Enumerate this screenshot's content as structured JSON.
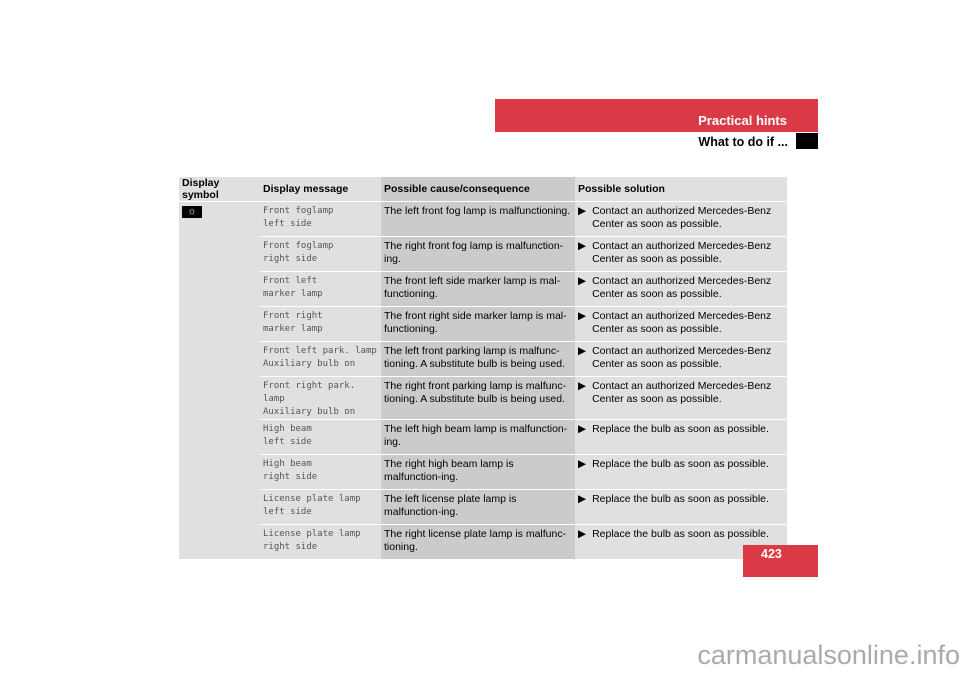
{
  "header": {
    "section": "Practical hints",
    "subsection": "What to do if ..."
  },
  "page_number": "423",
  "watermark": "carmanualsonline.info",
  "table": {
    "headers": [
      "Display symbol",
      "Display message",
      "Possible cause/consequence",
      "Possible solution"
    ],
    "symbol_icon": "lamp-icon",
    "rows": [
      {
        "msg1": "Front foglamp",
        "msg2": "left side",
        "cause": "The left front fog lamp is malfunctioning.",
        "solution": "Contact an authorized Mercedes-Benz Center as soon as possible."
      },
      {
        "msg1": "Front foglamp",
        "msg2": "right side",
        "cause": "The right front fog lamp is malfunction-ing.",
        "solution": "Contact an authorized Mercedes-Benz Center as soon as possible."
      },
      {
        "msg1": "Front left",
        "msg2": "marker lamp",
        "cause": "The front left side marker lamp is mal-functioning.",
        "solution": "Contact an authorized Mercedes-Benz Center as soon as possible."
      },
      {
        "msg1": "Front right",
        "msg2": "marker lamp",
        "cause": "The front right side marker lamp is mal-functioning.",
        "solution": "Contact an authorized Mercedes-Benz Center as soon as possible."
      },
      {
        "msg1": "Front left park. lamp",
        "msg2": "Auxiliary bulb on",
        "cause": "The left front parking lamp is malfunc-tioning. A substitute bulb is being used.",
        "solution": "Contact an authorized Mercedes-Benz Center as soon as possible."
      },
      {
        "msg1": "Front right park. lamp",
        "msg2": "Auxiliary bulb on",
        "cause": "The right front parking lamp is malfunc-tioning. A substitute bulb is being used.",
        "solution": "Contact an authorized Mercedes-Benz Center as soon as possible."
      },
      {
        "msg1": "High beam",
        "msg2": "left side",
        "cause": "The left high beam lamp is malfunction-ing.",
        "solution": "Replace the bulb as soon as possible."
      },
      {
        "msg1": "High beam",
        "msg2": "right side",
        "cause": "The right high beam lamp is malfunction-ing.",
        "solution": "Replace the bulb as soon as possible."
      },
      {
        "msg1": "License plate lamp",
        "msg2": "left side",
        "cause": "The left license plate lamp is malfunction-ing.",
        "solution": "Replace the bulb as soon as possible."
      },
      {
        "msg1": "License plate lamp",
        "msg2": "right side",
        "cause": "The right license plate lamp is malfunc-tioning.",
        "solution": "Replace the bulb as soon as possible."
      }
    ]
  }
}
